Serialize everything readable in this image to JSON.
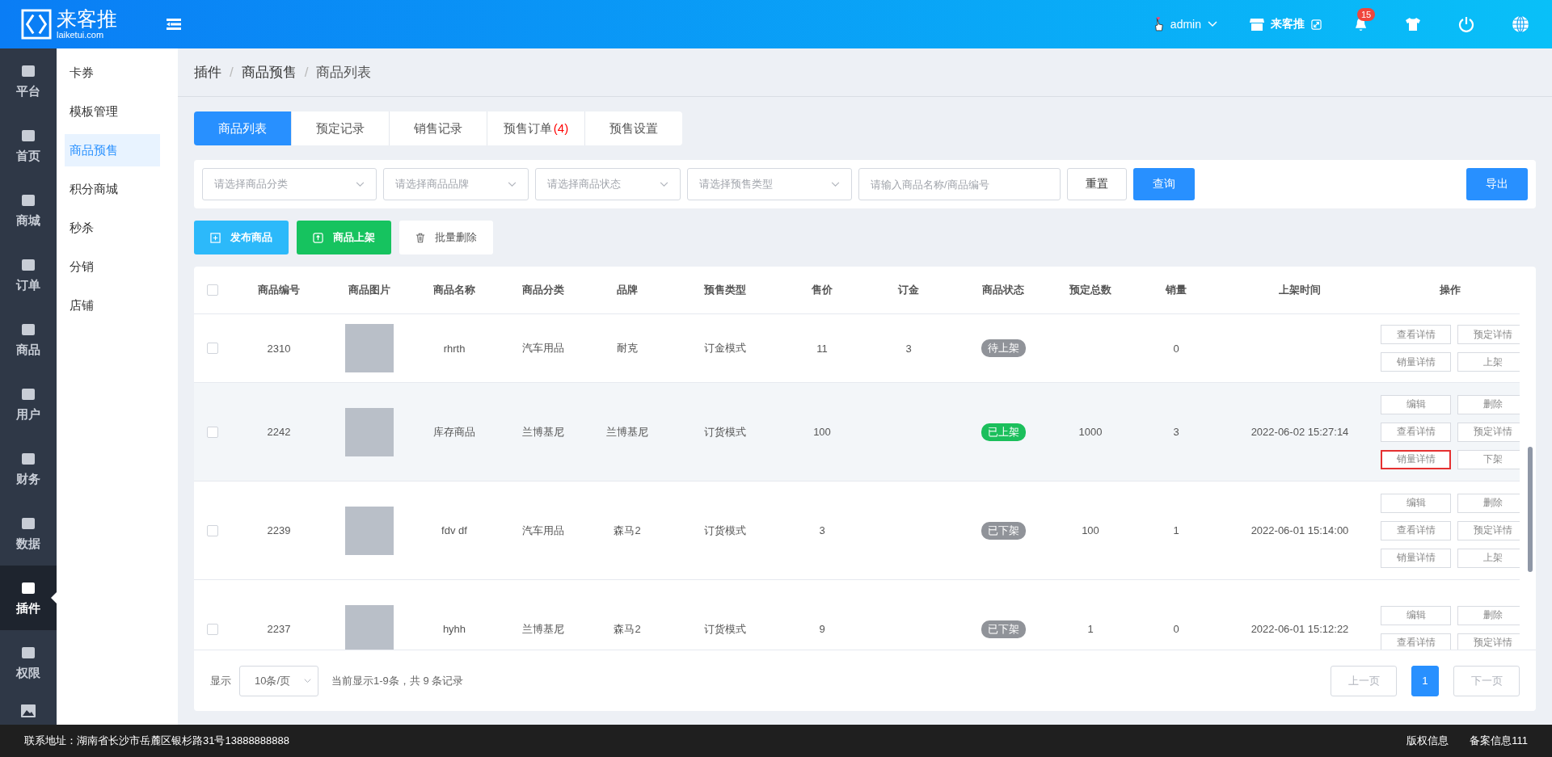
{
  "header": {
    "logo_text": "来客推",
    "logo_subtext": "laiketui.com",
    "user": "admin",
    "store": "来客推",
    "notification_count": "15"
  },
  "rail": [
    {
      "label": "平台",
      "selected": false
    },
    {
      "label": "首页",
      "selected": false
    },
    {
      "label": "商城",
      "selected": false
    },
    {
      "label": "订单",
      "selected": false
    },
    {
      "label": "商品",
      "selected": false
    },
    {
      "label": "用户",
      "selected": false
    },
    {
      "label": "财务",
      "selected": false
    },
    {
      "label": "数据",
      "selected": false
    },
    {
      "label": "插件",
      "selected": true
    },
    {
      "label": "权限",
      "selected": false
    }
  ],
  "submenu": [
    {
      "label": "卡券",
      "selected": false
    },
    {
      "label": "模板管理",
      "selected": false
    },
    {
      "label": "商品预售",
      "selected": true
    },
    {
      "label": "积分商城",
      "selected": false
    },
    {
      "label": "秒杀",
      "selected": false
    },
    {
      "label": "分销",
      "selected": false
    },
    {
      "label": "店铺",
      "selected": false
    }
  ],
  "breadcrumb": [
    "插件",
    "商品预售",
    "商品列表"
  ],
  "breadcrumb_separator": "/",
  "tabs": [
    {
      "label": "商品列表",
      "selected": true
    },
    {
      "label": "预定记录",
      "selected": false
    },
    {
      "label": "销售记录",
      "selected": false
    },
    {
      "label": "预售订单",
      "count": "(4)",
      "selected": false
    },
    {
      "label": "预售设置",
      "selected": false
    }
  ],
  "filters": {
    "selects": [
      "请选择商品分类",
      "请选择商品品牌",
      "请选择商品状态",
      "请选择预售类型"
    ],
    "search_placeholder": "请输入商品名称/商品编号",
    "reset": "重置",
    "query": "查询",
    "export": "导出"
  },
  "actions": [
    {
      "label": "发布商品",
      "kind": "publish"
    },
    {
      "label": "商品上架",
      "kind": "shelve"
    },
    {
      "label": "批量删除",
      "kind": "delete"
    }
  ],
  "table": {
    "header_checked": false,
    "columns": [
      "商品编号",
      "商品图片",
      "商品名称",
      "商品分类",
      "品牌",
      "预售类型",
      "售价",
      "订金",
      "商品状态",
      "预定总数",
      "销量",
      "上架时间",
      "操作"
    ],
    "rows": [
      {
        "id": "2310",
        "name": "rhrth",
        "category": "汽车用品",
        "brand": "耐克",
        "presale_type": "订金模式",
        "price": "11",
        "deposit": "3",
        "status": {
          "label": "待上架",
          "color": "#909399"
        },
        "reserved_total": "",
        "sales": "0",
        "listed_at": "",
        "checked": false,
        "hovered": false,
        "ops": [
          {
            "label": "查看详情",
            "marked": false
          },
          {
            "label": "预定详情",
            "marked": false
          },
          {
            "label": "销量详情",
            "marked": false
          },
          {
            "label": "上架",
            "marked": false
          }
        ]
      },
      {
        "id": "2242",
        "name": "库存商品",
        "category": "兰博基尼",
        "brand": "兰博基尼",
        "presale_type": "订货模式",
        "price": "100",
        "deposit": "",
        "status": {
          "label": "已上架",
          "color": "#1bbf5c"
        },
        "reserved_total": "1000",
        "sales": "3",
        "listed_at": "2022-06-02 15:27:14",
        "checked": false,
        "hovered": true,
        "ops": [
          {
            "label": "编辑",
            "marked": false
          },
          {
            "label": "删除",
            "marked": false
          },
          {
            "label": "查看详情",
            "marked": false
          },
          {
            "label": "预定详情",
            "marked": false
          },
          {
            "label": "销量详情",
            "marked": true
          },
          {
            "label": "下架",
            "marked": false
          }
        ]
      },
      {
        "id": "2239",
        "name": "fdv df",
        "category": "汽车用品",
        "brand": "森马2",
        "presale_type": "订货模式",
        "price": "3",
        "deposit": "",
        "status": {
          "label": "已下架",
          "color": "#909399"
        },
        "reserved_total": "100",
        "sales": "1",
        "listed_at": "2022-06-01 15:14:00",
        "checked": false,
        "hovered": false,
        "ops": [
          {
            "label": "编辑",
            "marked": false
          },
          {
            "label": "删除",
            "marked": false
          },
          {
            "label": "查看详情",
            "marked": false
          },
          {
            "label": "预定详情",
            "marked": false
          },
          {
            "label": "销量详情",
            "marked": false
          },
          {
            "label": "上架",
            "marked": false
          }
        ]
      },
      {
        "id": "2237",
        "name": "hyhh",
        "category": "兰博基尼",
        "brand": "森马2",
        "presale_type": "订货模式",
        "price": "9",
        "deposit": "",
        "status": {
          "label": "已下架",
          "color": "#909399"
        },
        "reserved_total": "1",
        "sales": "0",
        "listed_at": "2022-06-01 15:12:22",
        "checked": false,
        "hovered": false,
        "ops": [
          {
            "label": "编辑",
            "marked": false
          },
          {
            "label": "删除",
            "marked": false
          },
          {
            "label": "查看详情",
            "marked": false
          },
          {
            "label": "预定详情",
            "marked": false
          }
        ]
      }
    ]
  },
  "pagination": {
    "show_label": "显示",
    "page_size": "10条/页",
    "summary": "当前显示1-9条，共 9 条记录",
    "prev": "上一页",
    "pages": [
      {
        "label": "1",
        "selected": true
      }
    ],
    "next": "下一页"
  },
  "footer": {
    "address": "联系地址：湖南省长沙市岳麓区银杉路31号13888888888",
    "links": [
      "版权信息",
      "备案信息111"
    ]
  }
}
